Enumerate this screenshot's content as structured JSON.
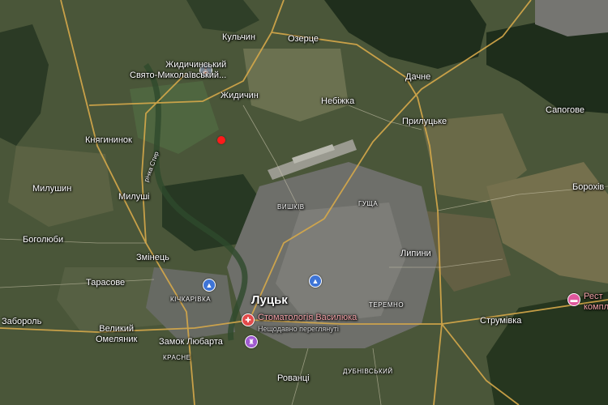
{
  "map": {
    "places": {
      "kulchyn": "Кульчин",
      "ozertse": "Озерце",
      "zhydychynskyi_monastery": "Жидичинський\nСвято-Миколаївський...",
      "zhydychyn": "Жидичин",
      "nebizhka": "Небіжка",
      "dachne": "Дачне",
      "prylutske": "Прилуцьке",
      "sapohove": "Сапогове",
      "knyahyninok": "Княгининок",
      "river_styr": "річка Стир",
      "milushyn": "Милушин",
      "milushi": "Милуші",
      "vyshkiv": "ВИШКІВ",
      "hushcha": "ГУЩА",
      "borokhiv": "Борохів",
      "boholiuby": "Боголюби",
      "zmiinets": "Змінець",
      "lypyny": "Липини",
      "tarasove": "Тарасове",
      "kichkarivka": "КІЧКАРІВКА",
      "lutsk": "Луцьк",
      "teremno": "ТЕРЕМНО",
      "zaborol": "Забороль",
      "velykyi_omelianyk": "Великий\nОмеляник",
      "strumivka": "Струмівка",
      "restaurant_complex": "Рест\nкомпл",
      "dentistry": "Стоматологія Василюка",
      "dentistry_sub": "Нещодавно переглянуті",
      "lubart_castle": "Замок Любарта",
      "krasne": "КРАСНЕ",
      "rovantsi": "Рованці",
      "dubnivskyi": "ДУБНІВСЬКИЙ"
    },
    "icons": {
      "monastery": "church-icon",
      "kichkarivka_poi": "landmark-icon",
      "lutsk_poi": "landmark-icon",
      "dentistry": "medical-icon",
      "castle": "castle-icon",
      "restaurant": "hotel-icon",
      "dropped_pin": "location-marker"
    }
  }
}
